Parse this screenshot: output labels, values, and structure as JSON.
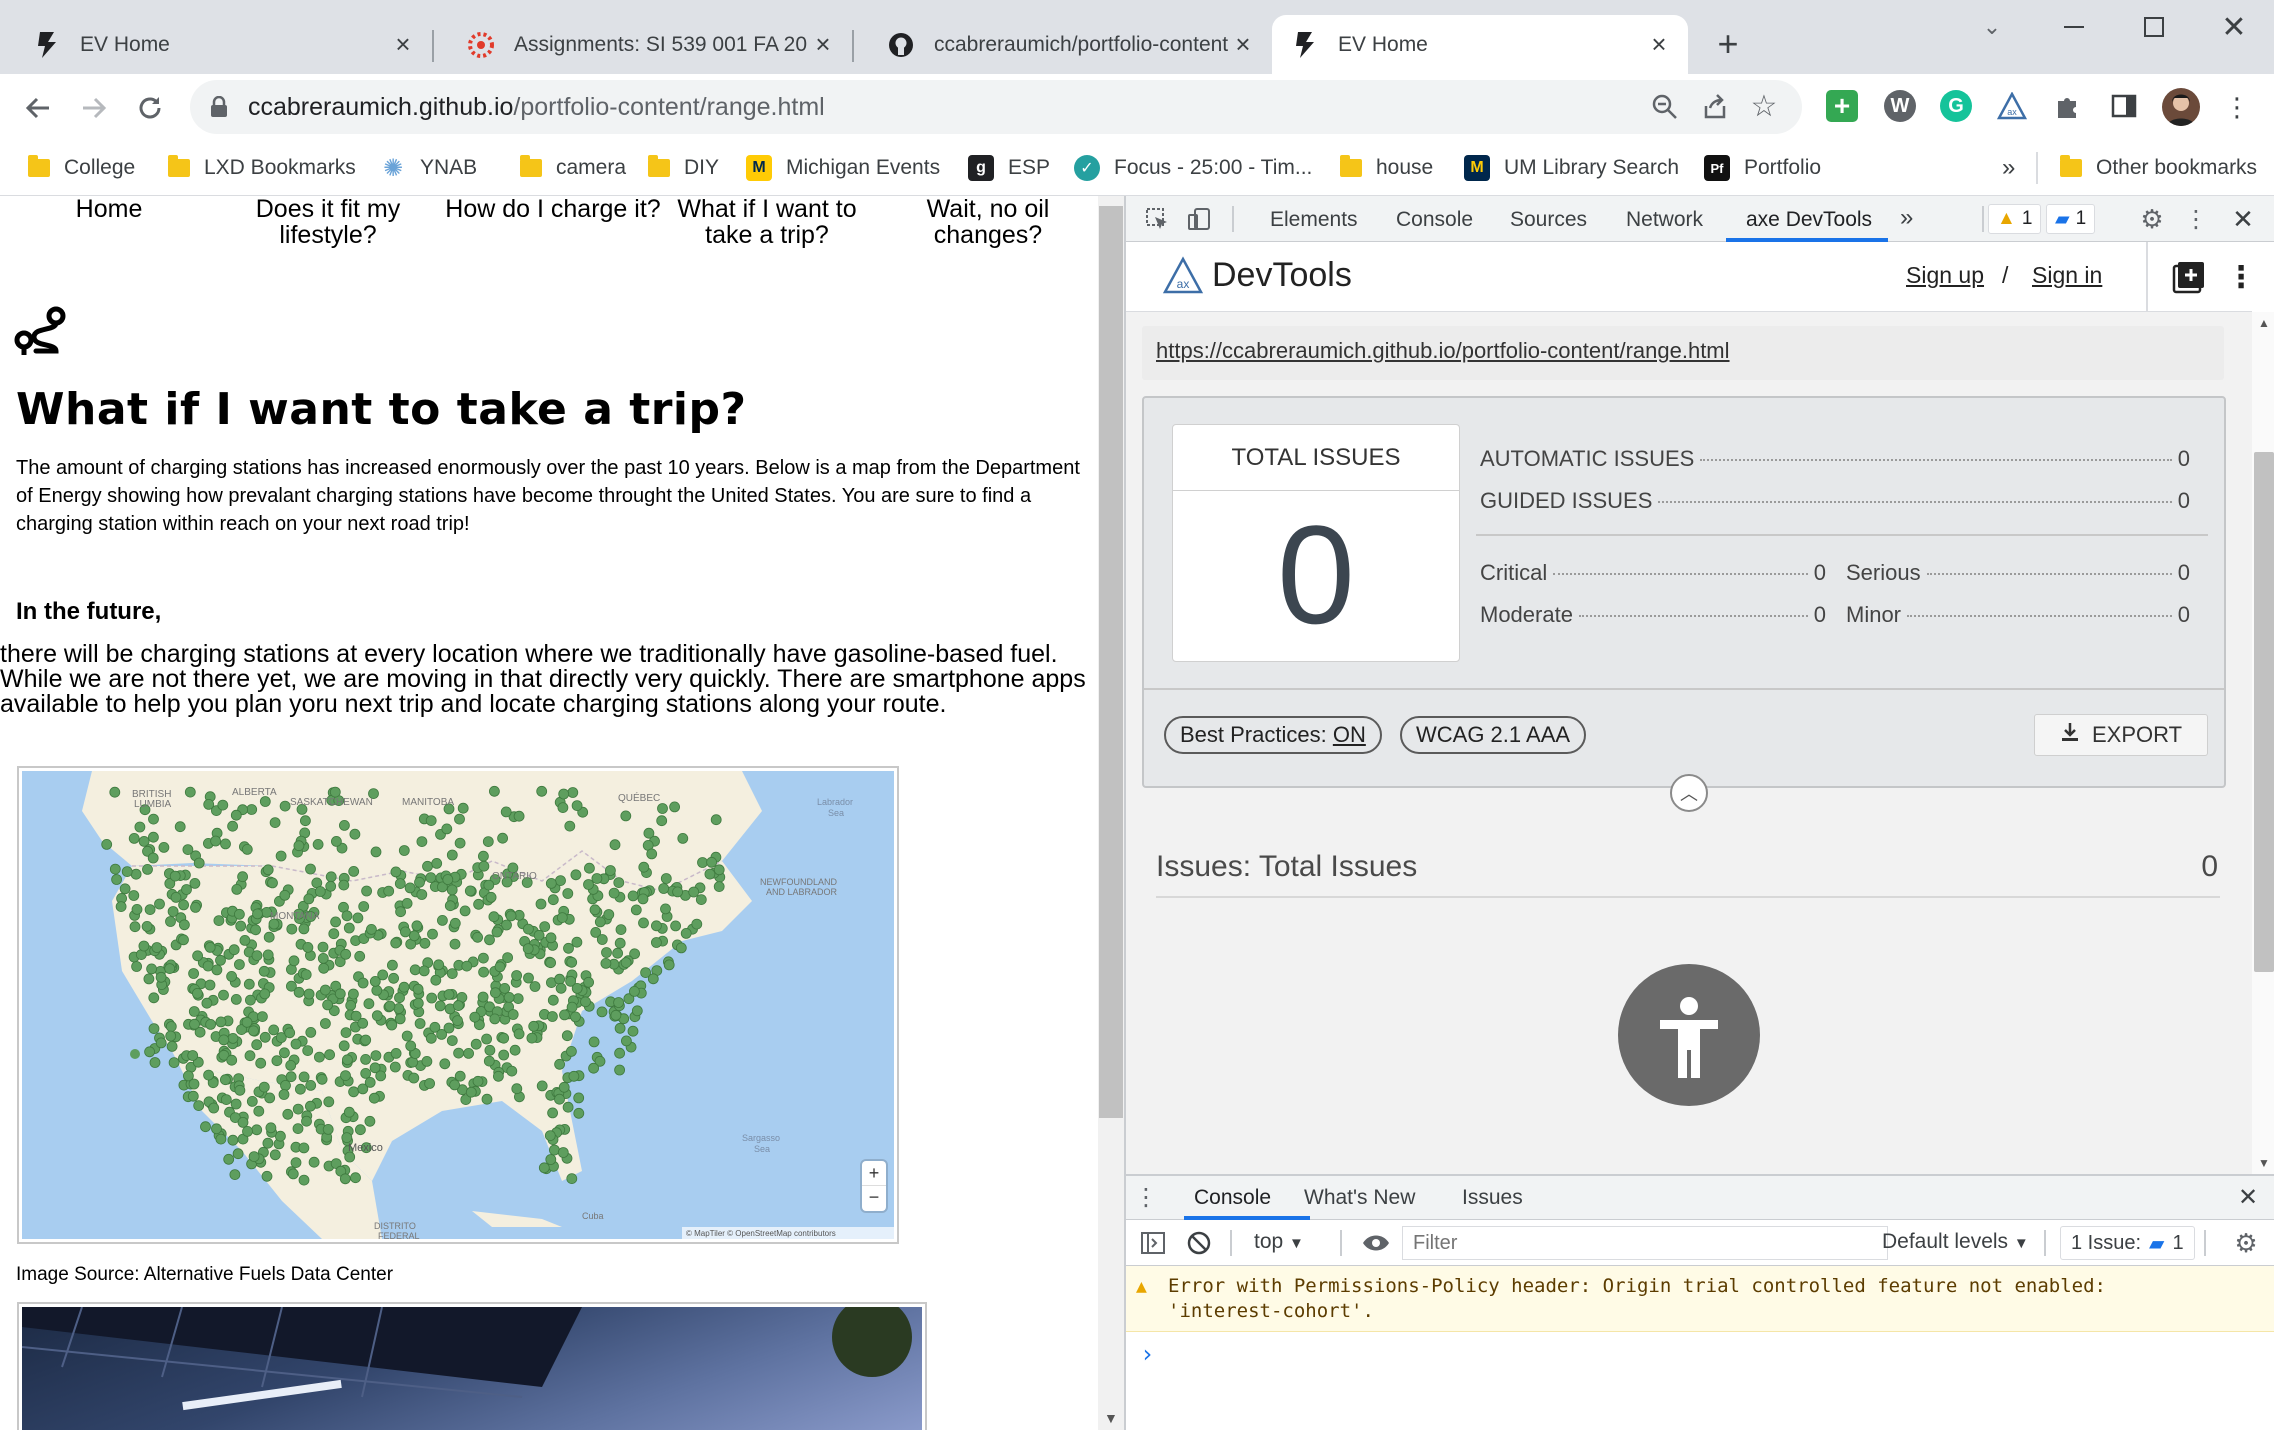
{
  "browser": {
    "tabs": [
      {
        "title": "EV Home",
        "active": false
      },
      {
        "title": "Assignments: SI 539 001 FA 2022",
        "active": false
      },
      {
        "title": "ccabreraumich/portfolio-content",
        "active": false
      },
      {
        "title": "EV Home",
        "active": true
      }
    ],
    "new_tab_symbol": "+",
    "url_host": "ccabreraumich.github.io",
    "url_path": "/portfolio-content/range.html",
    "bookmarks": [
      {
        "label": "College",
        "icon": "folder-icon"
      },
      {
        "label": "LXD Bookmarks",
        "icon": "folder-icon"
      },
      {
        "label": "YNAB",
        "icon": "ynab-icon"
      },
      {
        "label": "camera",
        "icon": "folder-icon"
      },
      {
        "label": "DIY",
        "icon": "folder-icon"
      },
      {
        "label": "Michigan Events",
        "icon": "michigan-events-icon"
      },
      {
        "label": "ESP",
        "icon": "esp-icon"
      },
      {
        "label": "Focus - 25:00 - Tim...",
        "icon": "focus-check-icon"
      },
      {
        "label": "house",
        "icon": "folder-icon"
      },
      {
        "label": "UM Library Search",
        "icon": "um-logo-icon"
      },
      {
        "label": "Portfolio",
        "icon": "portfolio-icon"
      }
    ],
    "bookmarks_overflow": "»",
    "other_bookmarks": "Other bookmarks"
  },
  "page": {
    "nav": [
      "Home",
      "Does it fit my lifestyle?",
      "How do I charge it?",
      "What if I want to take a trip?",
      "Wait, no oil changes?"
    ],
    "heading": "What if I want to take a trip?",
    "intro": "The amount of charging stations has increased enormously over the past 10 years. Below is a map from the Department of Energy showing how prevalant charging stations have become throught the United States. You are sure to find a charging station within reach on your next road trip!",
    "subheading": "In the future,",
    "future_text": "there will be charging stations at every location where we traditionally have gasoline-based fuel. While we are not there yet, we are moving in that directly very quickly. There are smartphone apps available to help you plan yoru next trip and locate charging stations along your route.",
    "map_labels": {
      "british_columbia": "BRITISH\nCOLUMBIA",
      "alberta": "ALBERTA",
      "saskatchewan": "SASKATCHEWAN",
      "manitoba": "MANITOBA",
      "quebec": "QUÉBEC",
      "ontario": "ONTARIO",
      "labrador_sea": "Labrador\nSea",
      "newfoundland": "NEWFOUNDLAND\nAND LABRADOR",
      "montana": "MONTANA",
      "mexico": "Mexico",
      "sargasso": "Sargasso\nSea",
      "cuba": "Cuba",
      "distrito": "DISTRITO\nFEDERAL",
      "attribution": "© MapTiler © OpenStreetMap contributors",
      "zoom_in": "+",
      "zoom_out": "−"
    },
    "caption": "Image Source: Alternative Fuels Data Center"
  },
  "devtools": {
    "tabs": [
      "Elements",
      "Console",
      "Sources",
      "Network",
      "axe DevTools"
    ],
    "active_tab": "axe DevTools",
    "more": "»",
    "warning_count": "1",
    "message_count": "1",
    "axe": {
      "brand": "DevTools",
      "sign_up": "Sign up",
      "sep": "/",
      "sign_in": "Sign in",
      "url": "https://ccabreraumich.github.io/portfolio-content/range.html",
      "total_issues_label": "TOTAL ISSUES",
      "total_issues": "0",
      "automatic_label": "AUTOMATIC ISSUES",
      "automatic": "0",
      "guided_label": "GUIDED ISSUES",
      "guided": "0",
      "critical_label": "Critical",
      "critical": "0",
      "serious_label": "Serious",
      "serious": "0",
      "moderate_label": "Moderate",
      "moderate": "0",
      "minor_label": "Minor",
      "minor": "0",
      "best_practices_label": "Best Practices:",
      "best_practices_value": "ON",
      "standard": "WCAG 2.1 AAA",
      "export": "EXPORT",
      "issues_title": "Issues: Total Issues",
      "issues_count": "0"
    },
    "drawer": {
      "tabs": [
        "Console",
        "What's New",
        "Issues"
      ],
      "context": "top",
      "filter_placeholder": "Filter",
      "levels": "Default levels",
      "issue_badge_label": "1 Issue:",
      "issue_badge_count": "1",
      "warning_line1": "Error with Permissions-Policy header: Origin trial controlled feature not enabled:",
      "warning_line2": "'interest-cohort'.",
      "prompt": "›"
    }
  },
  "colors": {
    "map_water": "#a8cdf0",
    "map_land": "#f4efdf",
    "station_dot": "#5e9e5e",
    "accent_blue": "#1a73e8",
    "axe_gray": "#6a6a6a"
  }
}
